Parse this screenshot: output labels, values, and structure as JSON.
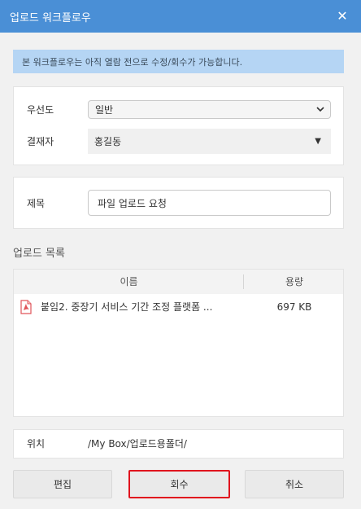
{
  "dialog": {
    "title": "업로드 워크플로우",
    "close_icon": "close-icon"
  },
  "info_text": "본 워크플로우는 아직 열람 전으로 수정/회수가 가능합니다.",
  "form": {
    "priority_label": "우선도",
    "priority_value": "일반",
    "approver_label": "결재자",
    "approver_value": "홍길동",
    "subject_label": "제목",
    "subject_value": "파일 업로드 요청"
  },
  "upload_list": {
    "title": "업로드 목록",
    "columns": {
      "name": "이름",
      "size": "용량"
    },
    "rows": [
      {
        "icon": "pdf-icon",
        "name": "붙임2. 중장기 서비스 기간 조정 플랫폼 ...",
        "size": "697 KB"
      }
    ]
  },
  "location": {
    "label": "위치",
    "value": "/My Box/업로드용폴더/"
  },
  "buttons": {
    "edit": "편집",
    "recall": "회수",
    "cancel": "취소"
  },
  "colors": {
    "titlebar": "#4a8fd6",
    "info_bg": "#b5d5f4",
    "highlight_border": "#e0141e"
  }
}
